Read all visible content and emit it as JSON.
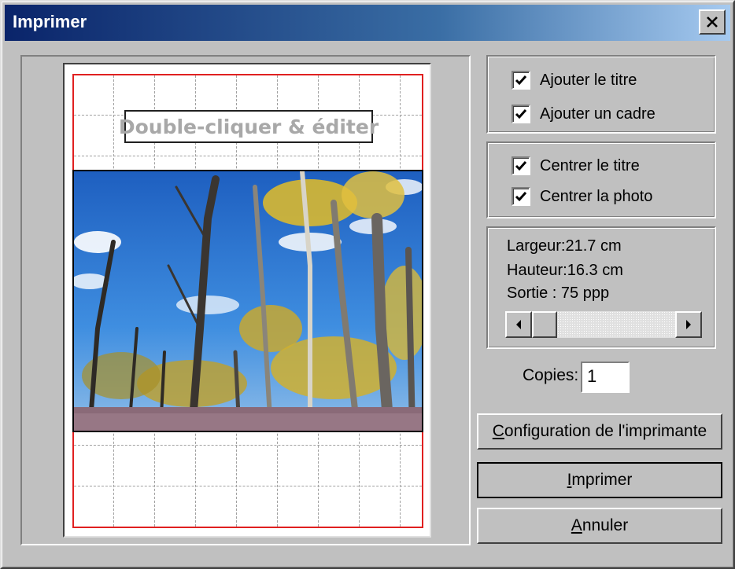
{
  "window": {
    "title": "Imprimer"
  },
  "preview": {
    "title_placeholder": "Double-cliquer & éditer"
  },
  "options_title": [
    {
      "label": "Ajouter le titre",
      "checked": true
    },
    {
      "label": "Ajouter un cadre",
      "checked": true
    }
  ],
  "options_center": [
    {
      "label": "Centrer le titre",
      "checked": true
    },
    {
      "label": "Centrer la photo",
      "checked": true
    }
  ],
  "dimensions": {
    "width": "Largeur:21.7 cm",
    "height": "Hauteur:16.3 cm",
    "output": "Sortie : 75 ppp"
  },
  "copies": {
    "label": "Copies:",
    "value": "1"
  },
  "buttons": {
    "printer_setup_first": "C",
    "printer_setup_rest": "onfiguration de l'imprimante",
    "print_first": "I",
    "print_rest": "mprimer",
    "cancel_first": "A",
    "cancel_rest": "nnuler"
  }
}
